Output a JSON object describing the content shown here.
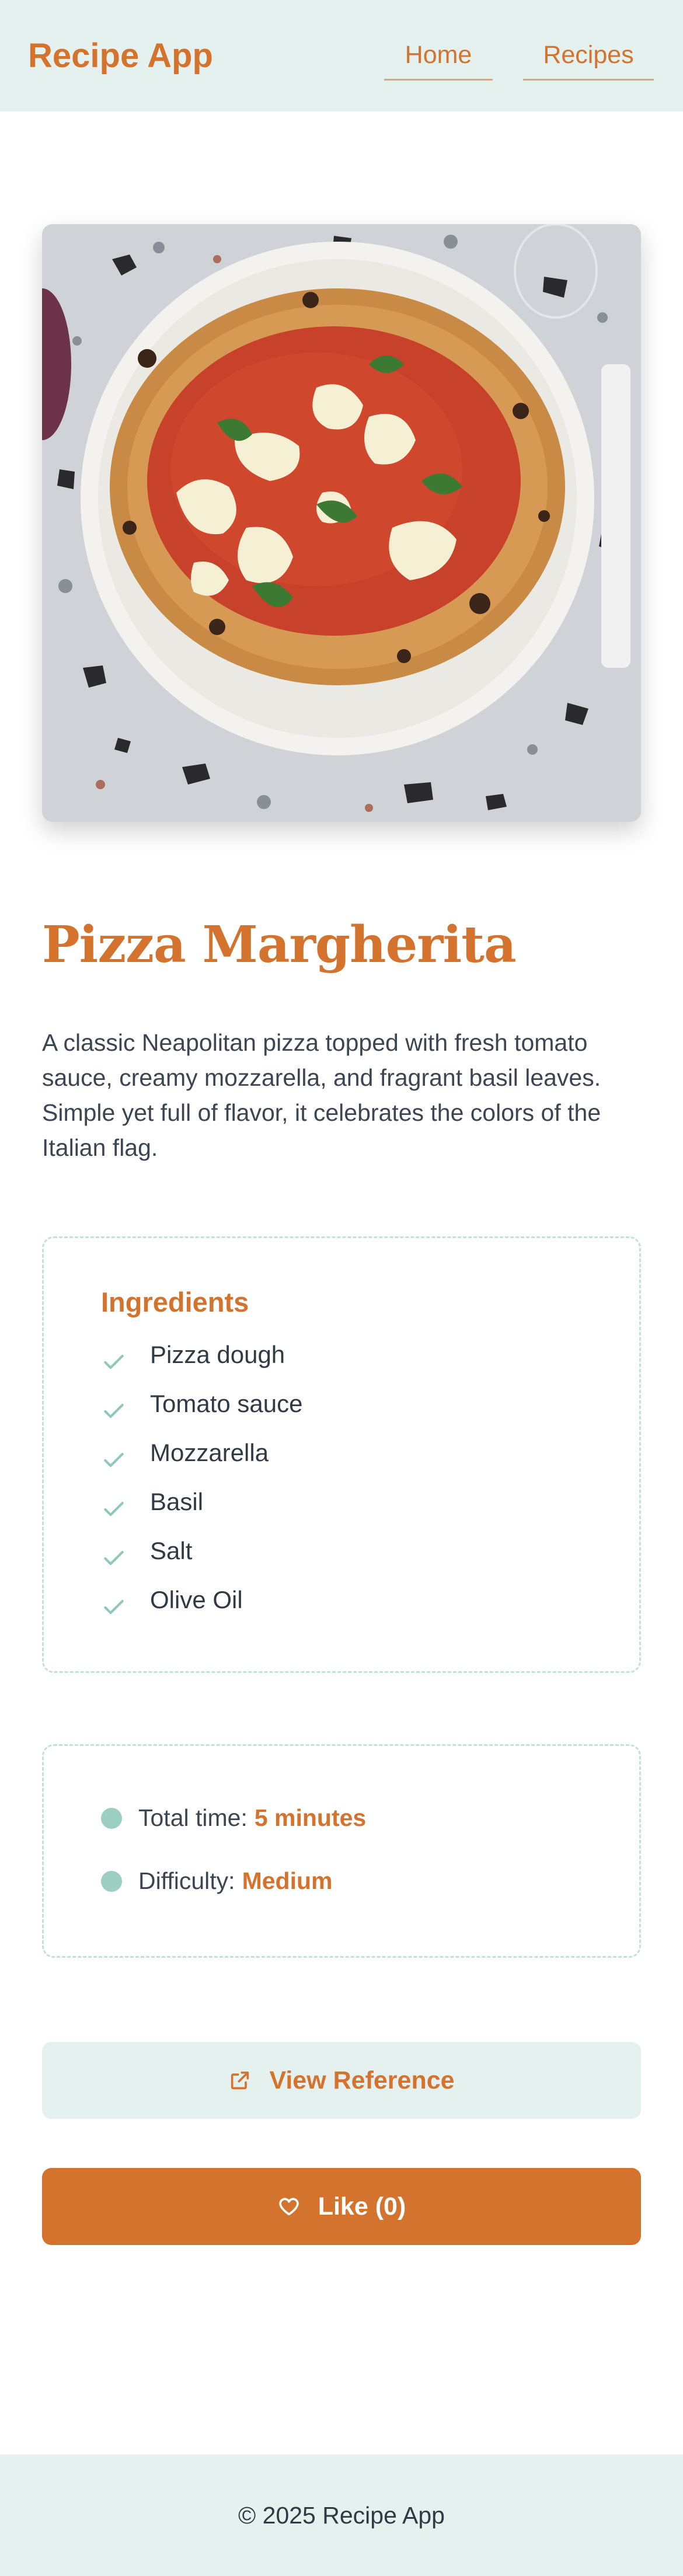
{
  "header": {
    "brand": "Recipe App",
    "nav": [
      {
        "label": "Home"
      },
      {
        "label": "Recipes"
      }
    ]
  },
  "recipe": {
    "image_alt": "Pizza Margherita photo",
    "title": "Pizza Margherita",
    "description": "A classic Neapolitan pizza topped with fresh tomato sauce, creamy mozzarella, and fragrant basil leaves. Simple yet full of flavor, it celebrates the colors of the Italian flag."
  },
  "ingredients": {
    "title": "Ingredients",
    "items": [
      "Pizza dough",
      "Tomato sauce",
      "Mozzarella",
      "Basil",
      "Salt",
      "Olive Oil"
    ],
    "icon": "check-icon"
  },
  "info": {
    "total_time_label": "Total time:",
    "total_time_value": "5 minutes",
    "difficulty_label": "Difficulty:",
    "difficulty_value": "Medium"
  },
  "actions": {
    "reference_label": "View Reference",
    "reference_icon": "external-link-icon",
    "like_label": "Like (0)",
    "like_icon": "heart-icon"
  },
  "footer": {
    "text": "© 2025 Recipe App"
  },
  "colors": {
    "accent": "#d4732d",
    "mint": "#e5f1ee",
    "mint_border": "#c3e0d9",
    "dot": "#9ccfc1",
    "text": "#2f3a45"
  }
}
